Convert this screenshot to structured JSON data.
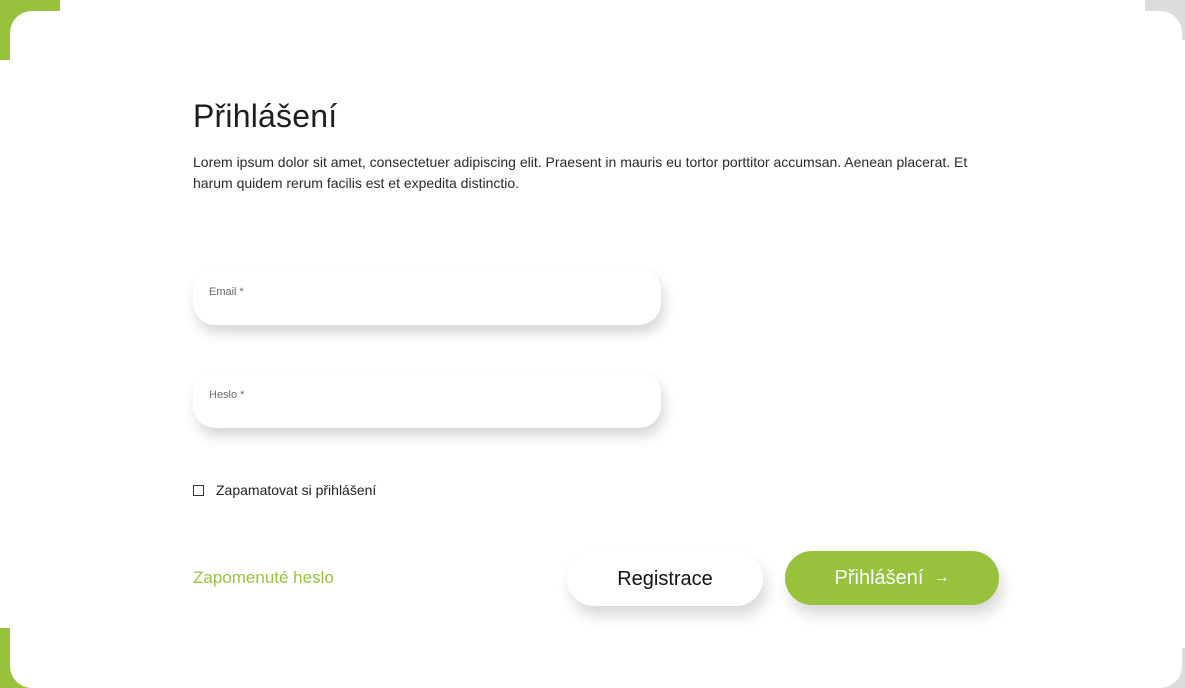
{
  "colors": {
    "accent": "#98c23c",
    "text": "#1e1e1e",
    "background": "#ffffff"
  },
  "login": {
    "title": "Přihlášení",
    "intro": "Lorem ipsum dolor sit amet, consectetuer adipiscing elit. Praesent in mauris eu tortor porttitor accumsan. Aenean placerat. Et harum quidem rerum facilis est et expedita distinctio.",
    "email": {
      "label": "Email *",
      "value": ""
    },
    "password": {
      "label": "Heslo *",
      "value": ""
    },
    "remember": {
      "label": "Zapamatovat si přihlášení",
      "checked": false
    },
    "forgot_link": "Zapomenuté heslo",
    "register_button": "Registrace",
    "login_button": "Přihlášení",
    "login_button_icon": "arrow-right-icon"
  }
}
